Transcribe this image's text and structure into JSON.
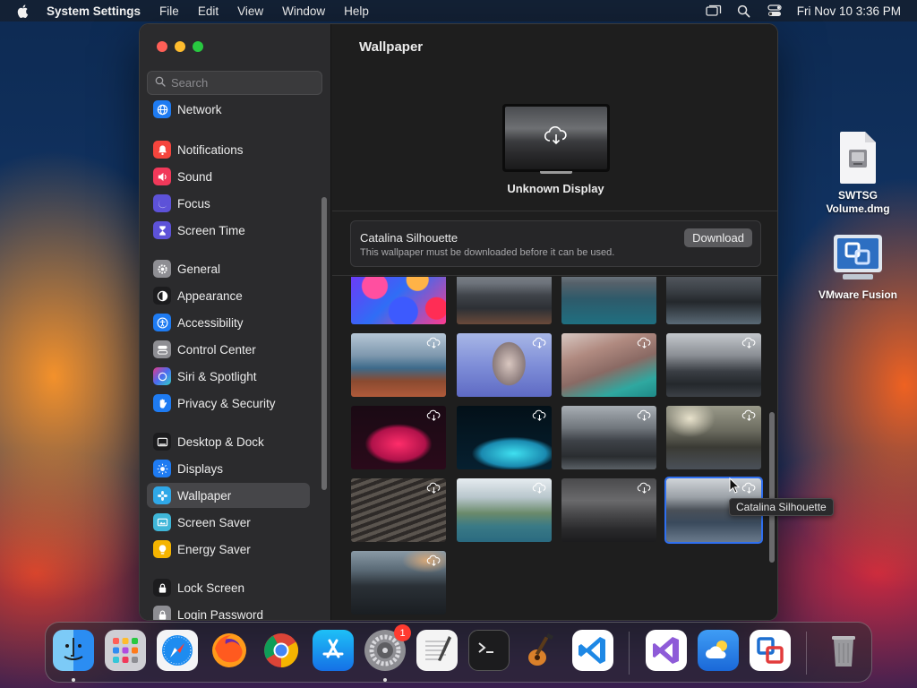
{
  "menubar": {
    "app_name": "System Settings",
    "menus": [
      "File",
      "Edit",
      "View",
      "Window",
      "Help"
    ],
    "clock": "Fri Nov 10  3:36 PM"
  },
  "sidebar": {
    "search_placeholder": "Search",
    "items": [
      {
        "label": "Network",
        "icon": "globe-icon",
        "color": "#1e7bf2"
      },
      {
        "label": "Notifications",
        "icon": "bell-icon",
        "color": "#f5453d"
      },
      {
        "label": "Sound",
        "icon": "speaker-icon",
        "color": "#f1395a"
      },
      {
        "label": "Focus",
        "icon": "moon-icon",
        "color": "#5d52d8"
      },
      {
        "label": "Screen Time",
        "icon": "hourglass-icon",
        "color": "#5d52d8"
      },
      {
        "label": "General",
        "icon": "gear-icon",
        "color": "#8e8e93"
      },
      {
        "label": "Appearance",
        "icon": "circle-half-icon",
        "color": "#1c1c1e"
      },
      {
        "label": "Accessibility",
        "icon": "accessibility-icon",
        "color": "#1e7bf2"
      },
      {
        "label": "Control Center",
        "icon": "toggles-icon",
        "color": "#8e8e93"
      },
      {
        "label": "Siri & Spotlight",
        "icon": "siri-icon",
        "color": "#b04de0"
      },
      {
        "label": "Privacy & Security",
        "icon": "hand-icon",
        "color": "#1e7bf2"
      },
      {
        "label": "Desktop & Dock",
        "icon": "dock-icon",
        "color": "#1c1c1e"
      },
      {
        "label": "Displays",
        "icon": "sun-icon",
        "color": "#1e7bf2"
      },
      {
        "label": "Wallpaper",
        "icon": "flower-icon",
        "color": "#2fa8e8"
      },
      {
        "label": "Screen Saver",
        "icon": "screensaver-icon",
        "color": "#3fb6d8"
      },
      {
        "label": "Energy Saver",
        "icon": "bulb-icon",
        "color": "#f5b400"
      },
      {
        "label": "Lock Screen",
        "icon": "lock-icon",
        "color": "#1c1c1e"
      },
      {
        "label": "Login Password",
        "icon": "lock-icon",
        "color": "#8e8e93"
      }
    ],
    "selected": "Wallpaper"
  },
  "content": {
    "title": "Wallpaper",
    "display_name": "Unknown Display",
    "wallpaper_name": "Catalina Silhouette",
    "wallpaper_note": "This wallpaper must be downloaded before it can be used.",
    "download_label": "Download",
    "tooltip": "Catalina Silhouette"
  },
  "desktop": {
    "icons": [
      {
        "label": "SWTSG Volume.dmg",
        "icon": "disk-image-icon"
      },
      {
        "label": "VMware Fusion",
        "icon": "vmware-fusion-icon"
      }
    ]
  },
  "dock": {
    "apps": [
      {
        "name": "finder-icon",
        "color": "#2f9bf4"
      },
      {
        "name": "launchpad-icon",
        "color": "#d7d7dc"
      },
      {
        "name": "safari-icon",
        "color": "#1d8cf0"
      },
      {
        "name": "firefox-icon",
        "color": "#ff7a1a"
      },
      {
        "name": "chrome-icon",
        "color": "#ffffff"
      },
      {
        "name": "app-store-icon",
        "color": "#1e8cf5"
      },
      {
        "name": "system-settings-icon",
        "color": "#8e8e93"
      },
      {
        "name": "textedit-icon",
        "color": "#f2f2f2"
      },
      {
        "name": "terminal-icon",
        "color": "#1c1c1e"
      },
      {
        "name": "garageband-icon",
        "color": "#2b2b2b"
      },
      {
        "name": "vscode-icon",
        "color": "#ffffff"
      },
      {
        "name": "visual-studio-icon",
        "color": "#ffffff"
      },
      {
        "name": "weather-icon",
        "color": "#3a8ff0"
      },
      {
        "name": "vmware-fusion-icon",
        "color": "#ffffff"
      },
      {
        "name": "trash-icon",
        "color": "#9a9a9e"
      }
    ],
    "settings_badge": "1"
  }
}
